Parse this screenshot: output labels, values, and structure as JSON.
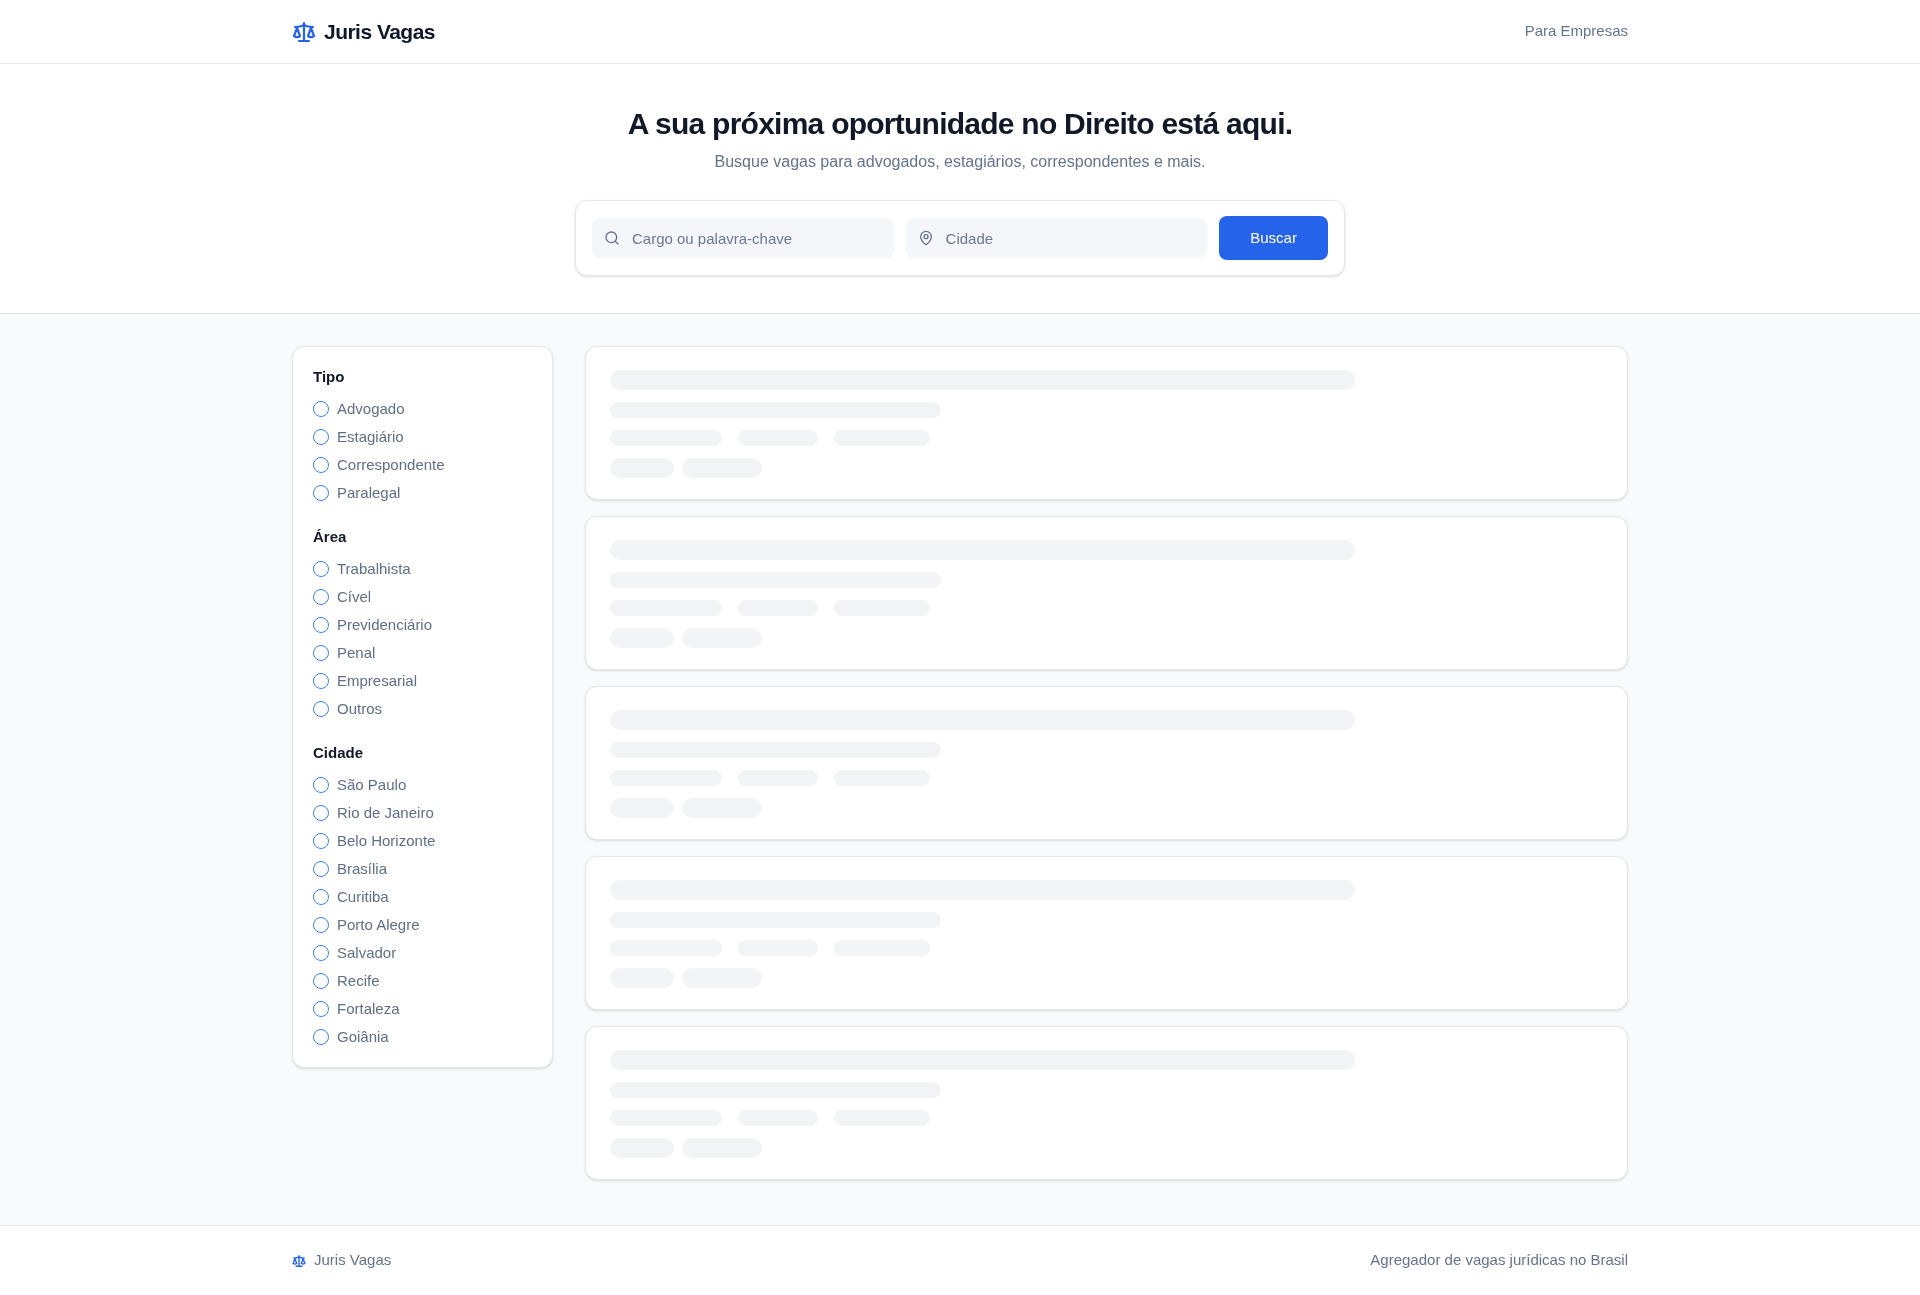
{
  "header": {
    "brand": "Juris Vagas",
    "nav_link": "Para Empresas"
  },
  "hero": {
    "title": "A sua próxima oportunidade no Direito está aqui.",
    "subtitle": "Busque vagas para advogados, estagiários, correspondentes e mais."
  },
  "search": {
    "keyword": {
      "placeholder": "Cargo ou palavra-chave"
    },
    "city": {
      "placeholder": "Cidade"
    },
    "button": "Buscar"
  },
  "filters": [
    {
      "title": "Tipo",
      "options": [
        {
          "label": "Advogado",
          "selected": false
        },
        {
          "label": "Estagiário",
          "selected": false
        },
        {
          "label": "Correspondente",
          "selected": false
        },
        {
          "label": "Paralegal",
          "selected": false
        }
      ]
    },
    {
      "title": "Área",
      "options": [
        {
          "label": "Trabalhista",
          "selected": false
        },
        {
          "label": "Cível",
          "selected": false
        },
        {
          "label": "Previdenciário",
          "selected": false
        },
        {
          "label": "Penal",
          "selected": false
        },
        {
          "label": "Empresarial",
          "selected": false
        },
        {
          "label": "Outros",
          "selected": false
        }
      ]
    },
    {
      "title": "Cidade",
      "options": [
        {
          "label": "São Paulo",
          "selected": false
        },
        {
          "label": "Rio de Janeiro",
          "selected": false
        },
        {
          "label": "Belo Horizonte",
          "selected": false
        },
        {
          "label": "Brasília",
          "selected": false
        },
        {
          "label": "Curitiba",
          "selected": false
        },
        {
          "label": "Porto Alegre",
          "selected": false
        },
        {
          "label": "Salvador",
          "selected": false
        },
        {
          "label": "Recife",
          "selected": false
        },
        {
          "label": "Fortaleza",
          "selected": false
        },
        {
          "label": "Goiânia",
          "selected": false
        }
      ]
    }
  ],
  "results": [
    {
      "kind": "skeleton"
    },
    {
      "kind": "skeleton"
    },
    {
      "kind": "skeleton"
    },
    {
      "kind": "skeleton"
    },
    {
      "kind": "skeleton"
    }
  ],
  "footer": {
    "brand": "Juris Vagas",
    "tagline": "Agregador de vagas jurídicas no Brasil"
  }
}
